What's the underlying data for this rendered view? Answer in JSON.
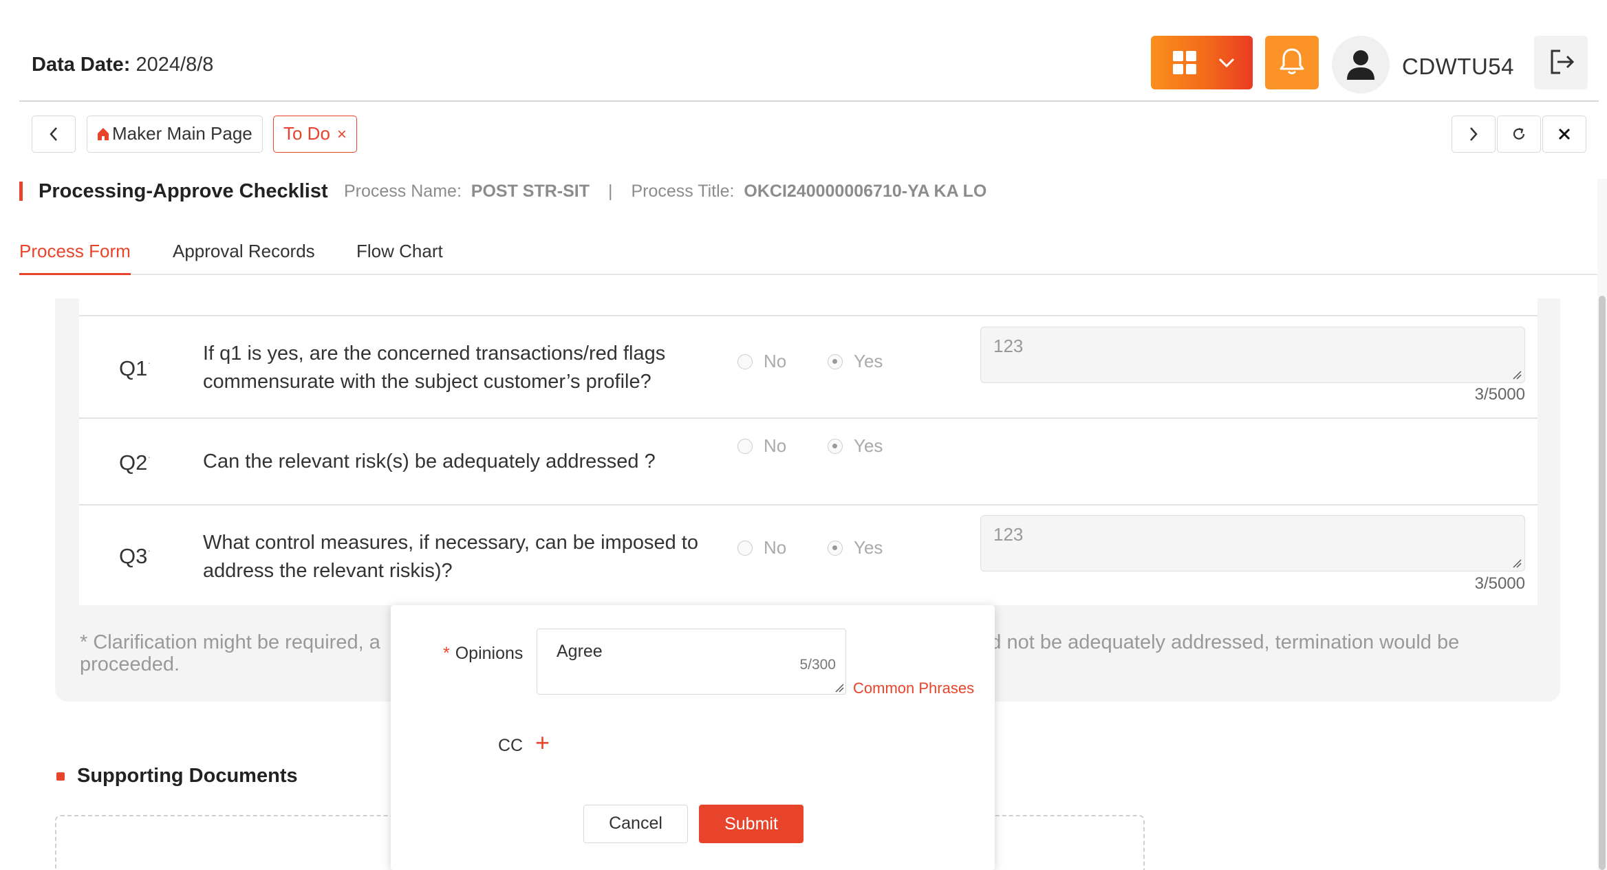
{
  "header": {
    "data_date_label": "Data Date:",
    "data_date_value": "2024/8/8",
    "username": "CDWTU54",
    "brand_gradient": [
      "#fb8f1d",
      "#ea3b22"
    ],
    "bell_color": "#fb9327"
  },
  "tab_strip": {
    "tabs": [
      {
        "label": "Maker Main Page",
        "icon": "home-icon",
        "active": false
      },
      {
        "label": "To Do",
        "close_glyph": "×",
        "active": true
      }
    ]
  },
  "page": {
    "title": "Processing-Approve Checklist",
    "process_name_label": "Process Name:",
    "process_name_value": "POST STR-SIT",
    "separator": "|",
    "process_title_label": "Process Title:",
    "process_title_value": "OKCI240000006710-YA KA LO",
    "accent_color": "#e8442c"
  },
  "main_tabs": [
    "Process Form",
    "Approval Records",
    "Flow Chart"
  ],
  "questions": [
    {
      "num": "Q1",
      "text": "If q1 is yes, are the concerned transactions/red flags commensurate with the subject customer’s profile?",
      "options": [
        "No",
        "Yes"
      ],
      "selected": "Yes",
      "remark": "123",
      "remark_count": "3/5000"
    },
    {
      "num": "Q2",
      "text": "Can the relevant risk(s) be adequately addressed ?",
      "options": [
        "No",
        "Yes"
      ],
      "selected": "Yes"
    },
    {
      "num": "Q3",
      "text": "What control measures, if necessary, can be imposed to address the relevant riskis)?",
      "options": [
        "No",
        "Yes"
      ],
      "selected": "Yes",
      "remark": "123",
      "remark_count": "3/5000"
    }
  ],
  "clarification": {
    "left": "* Clarification might be required, a",
    "right": "ld not be adequately addressed, termination would be",
    "line2": "proceeded."
  },
  "supporting_documents": {
    "title": "Supporting Documents"
  },
  "popup": {
    "opinions_label": "Opinions",
    "required_mark": "*",
    "opinions_value": "Agree",
    "opinions_count": "5/300",
    "common_phrases": "Common Phrases",
    "cc_label": "CC",
    "cc_add": "+",
    "cancel": "Cancel",
    "submit": "Submit"
  }
}
